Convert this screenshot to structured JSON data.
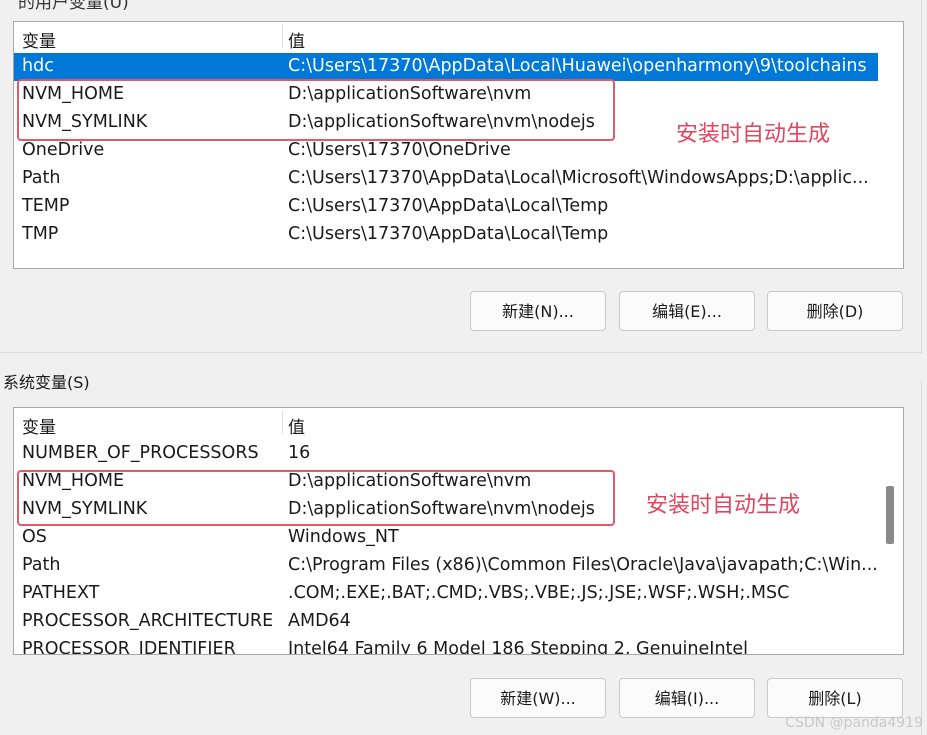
{
  "user_vars": {
    "title_clip": "的用户变量(U)",
    "headers": {
      "name": "变量",
      "value": "值"
    },
    "rows": [
      {
        "name": "hdc",
        "value": "C:\\Users\\17370\\AppData\\Local\\Huawei\\openharmony\\9\\toolchains"
      },
      {
        "name": "NVM_HOME",
        "value": "D:\\applicationSoftware\\nvm"
      },
      {
        "name": "NVM_SYMLINK",
        "value": "D:\\applicationSoftware\\nvm\\nodejs"
      },
      {
        "name": "OneDrive",
        "value": "C:\\Users\\17370\\OneDrive"
      },
      {
        "name": "Path",
        "value": "C:\\Users\\17370\\AppData\\Local\\Microsoft\\WindowsApps;D:\\applic..."
      },
      {
        "name": "TEMP",
        "value": "C:\\Users\\17370\\AppData\\Local\\Temp"
      },
      {
        "name": "TMP",
        "value": "C:\\Users\\17370\\AppData\\Local\\Temp"
      }
    ],
    "buttons": {
      "new": "新建(N)...",
      "edit": "编辑(E)...",
      "delete": "删除(D)"
    },
    "annotation": "安装时自动生成"
  },
  "system_vars": {
    "title": "系统变量(S)",
    "headers": {
      "name": "变量",
      "value": "值"
    },
    "rows": [
      {
        "name": "NUMBER_OF_PROCESSORS",
        "value": "16"
      },
      {
        "name": "NVM_HOME",
        "value": "D:\\applicationSoftware\\nvm"
      },
      {
        "name": "NVM_SYMLINK",
        "value": "D:\\applicationSoftware\\nvm\\nodejs"
      },
      {
        "name": "OS",
        "value": "Windows_NT"
      },
      {
        "name": "Path",
        "value": "C:\\Program Files (x86)\\Common Files\\Oracle\\Java\\javapath;C:\\Win..."
      },
      {
        "name": "PATHEXT",
        "value": ".COM;.EXE;.BAT;.CMD;.VBS;.VBE;.JS;.JSE;.WSF;.WSH;.MSC"
      },
      {
        "name": "PROCESSOR_ARCHITECTURE",
        "value": "AMD64"
      },
      {
        "name": "PROCESSOR_IDENTIFIER",
        "value": "Intel64 Family 6 Model 186 Stepping 2, GenuineIntel"
      }
    ],
    "buttons": {
      "new": "新建(W)...",
      "edit": "编辑(I)...",
      "delete": "删除(L)"
    },
    "annotation": "安装时自动生成"
  },
  "watermark": "CSDN @panda4919",
  "colors": {
    "selection": "#0078d7",
    "annotation": "#e0475f"
  }
}
